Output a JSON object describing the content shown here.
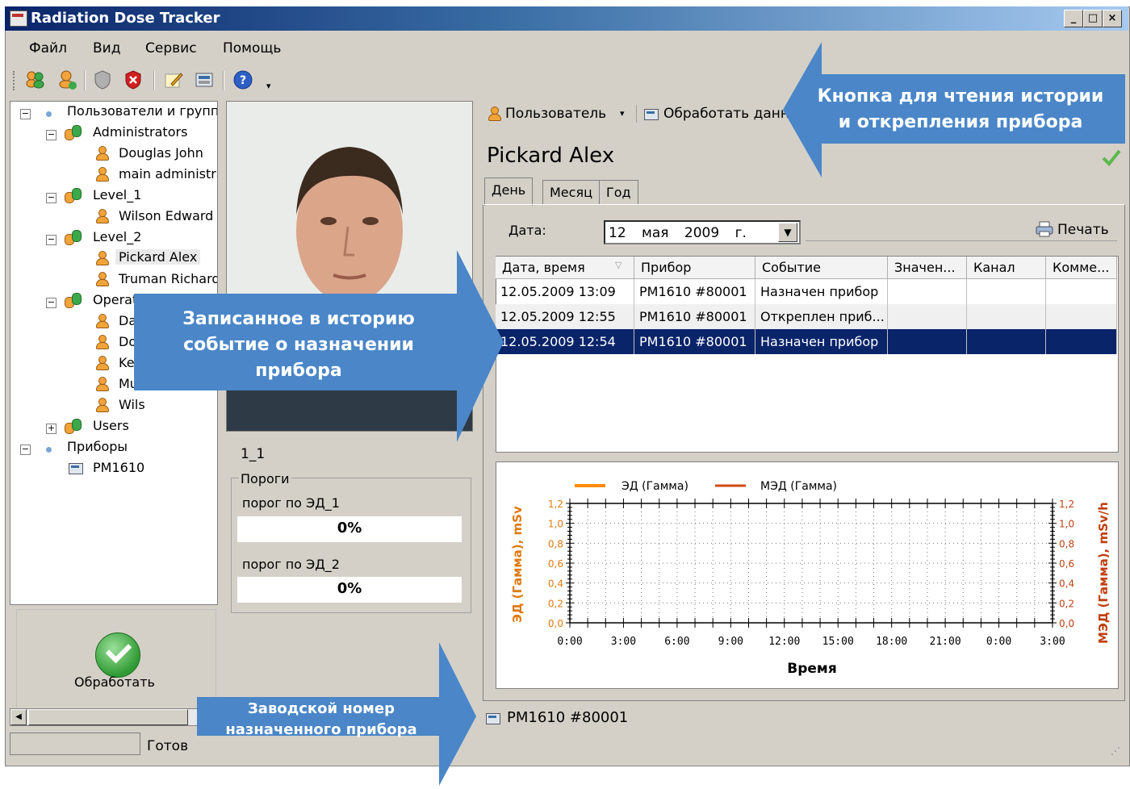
{
  "window": {
    "title": "Radiation Dose Tracker",
    "min": "_",
    "max": "□",
    "close": "×"
  },
  "menu": [
    "Файл",
    "Вид",
    "Сервис",
    "Помощь"
  ],
  "toolbar_icons": [
    "add-user-icon",
    "remove-user-icon",
    "shield-icon",
    "shield-delete-icon",
    "edit-icon",
    "device-icon",
    "help-icon",
    "overflow-icon"
  ],
  "tree": {
    "root_users": "Пользователи и групп",
    "groups": [
      {
        "name": "Administrators",
        "users": [
          "Douglas John",
          "main administra"
        ]
      },
      {
        "name": "Level_1",
        "users": [
          "Wilson Edward"
        ]
      },
      {
        "name": "Level_2",
        "users": [
          "Pickard Alex",
          "Truman Richard"
        ]
      },
      {
        "name": "Operato",
        "users": [
          "Dav",
          "Dou",
          "Kell",
          "Mur",
          "Wils"
        ]
      },
      {
        "name": "Users",
        "users": []
      }
    ],
    "root_devices": "Приборы",
    "device": "PM1610",
    "selected": "Pickard Alex"
  },
  "left_bottom": {
    "process_label": "Обработать",
    "status_text": "Готов"
  },
  "profile": {
    "code": "1_1",
    "thresholds_title": "Пороги",
    "thresholds": [
      {
        "label": "порог по ЭД_1",
        "value": "0%",
        "fraction": 0
      },
      {
        "label": "порог по ЭД_2",
        "value": "0%",
        "fraction": 0
      }
    ]
  },
  "right_toolbar": {
    "user_button": "Пользователь",
    "process_button": "Обработать данн"
  },
  "user_name": "Pickard Alex",
  "tabs": [
    "День",
    "Месяц",
    "Год"
  ],
  "date": {
    "label": "Дата:",
    "day": "12",
    "month": "мая",
    "year": "2009 г."
  },
  "print_label": "Печать",
  "grid": {
    "columns": [
      "Дата, время",
      "Прибор",
      "Событие",
      "Значен...",
      "Канал",
      "Комме..."
    ],
    "rows": [
      [
        "12.05.2009 13:09",
        "PM1610 #80001",
        "Назначен прибор",
        "",
        "",
        ""
      ],
      [
        "12.05.2009 12:55",
        "PM1610 #80001",
        "Откреплен приб...",
        "",
        "",
        ""
      ],
      [
        "12.05.2009 12:54",
        "PM1610 #80001",
        "Назначен прибор",
        "",
        "",
        ""
      ]
    ],
    "selected_row": 2
  },
  "chart_data": {
    "type": "line",
    "series": [
      {
        "name": "ЭД (Гамма)",
        "values": [],
        "color": "#ff8c00"
      },
      {
        "name": "МЭД (Гамма)",
        "values": [],
        "color": "#d04a10"
      }
    ],
    "x_ticks": [
      "0:00",
      "3:00",
      "6:00",
      "9:00",
      "12:00",
      "15:00",
      "18:00",
      "21:00",
      "0:00",
      "3:00"
    ],
    "y_ticks": [
      "0,0",
      "0,2",
      "0,4",
      "0,6",
      "0,8",
      "1,0",
      "1,2"
    ],
    "ylim": [
      0,
      1.2
    ],
    "xlabel": "Время",
    "ylabel_left": "ЭД (Гамма), mSv",
    "ylabel_right": "МЭД (Гамма), mSv/h",
    "legend": "top",
    "grid": true
  },
  "device_status": "PM1610 #80001",
  "callouts": {
    "top_right": [
      "Кнопка для чтения истории",
      "и открепления прибора"
    ],
    "middle": [
      "Записанное в историю",
      "событие о назначении",
      "прибора"
    ],
    "bottom": [
      "Заводской номер",
      "назначенного прибора"
    ]
  },
  "colors": {
    "callout": "#4a86c8",
    "selection": "#0a246a",
    "accent": "#ff8c00"
  }
}
